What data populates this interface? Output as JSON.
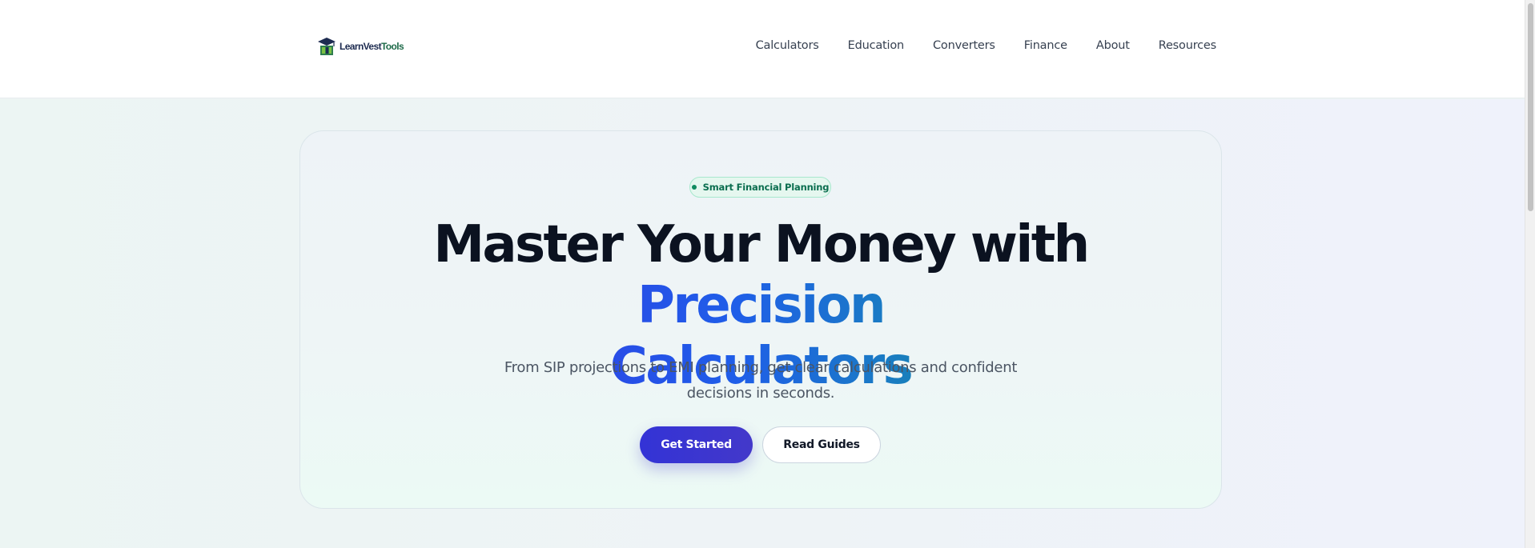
{
  "header": {
    "logo": {
      "brand_text_a": "LearnVest",
      "brand_text_b": "Tools",
      "icon": "graduation-cap-book-icon"
    },
    "nav": [
      {
        "label": "Calculators"
      },
      {
        "label": "Education"
      },
      {
        "label": "Converters"
      },
      {
        "label": "Finance"
      },
      {
        "label": "About"
      },
      {
        "label": "Resources"
      }
    ]
  },
  "hero": {
    "badge": "Smart Financial Planning",
    "headline_line1": "Master Your Money with",
    "headline_line2": "Precision Calculators",
    "subtitle": "From SIP projections to EMI planning, get clear calculations and confident decisions in seconds.",
    "primary_cta": "Get Started",
    "secondary_cta": "Read Guides"
  },
  "colors": {
    "primary": "#4338ca",
    "gradient_start": "#2f3fe6",
    "gradient_end": "#12909a",
    "badge_green": "#0b6e4f"
  }
}
